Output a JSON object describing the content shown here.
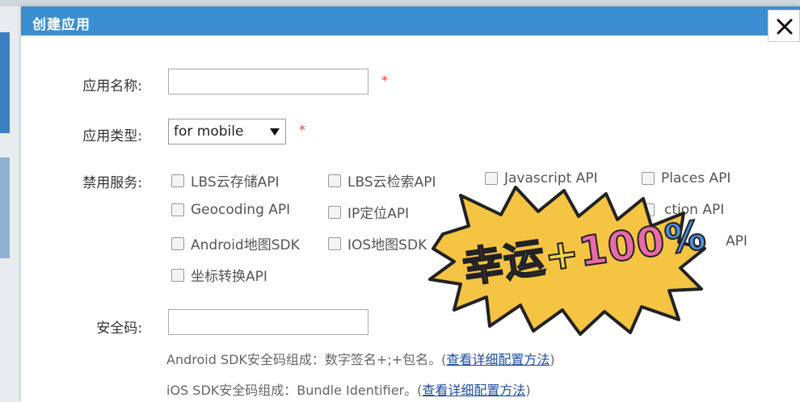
{
  "dialog": {
    "title": "创建应用",
    "close_icon": "close-icon"
  },
  "form": {
    "app_name": {
      "label": "应用名称:",
      "value": "",
      "required_mark": "*"
    },
    "app_type": {
      "label": "应用类型:",
      "selected": "for mobile",
      "required_mark": "*"
    },
    "disabled_services": {
      "label": "禁用服务:",
      "options": [
        {
          "label": "LBS云存储API",
          "checked": false
        },
        {
          "label": "LBS云检索API",
          "checked": false
        },
        {
          "label": "Javascript API",
          "checked": false
        },
        {
          "label": "Places API",
          "checked": false
        },
        {
          "label": "Geocoding API",
          "checked": false
        },
        {
          "label": "IP定位API",
          "checked": false
        },
        {
          "label": "ction API",
          "checked": false
        },
        {
          "label": "Android地图SDK",
          "checked": false
        },
        {
          "label": "IOS地图SDK",
          "checked": false
        },
        {
          "label": "API",
          "checked": false
        },
        {
          "label": "坐标转换API",
          "checked": false
        }
      ]
    },
    "security_code": {
      "label": "安全码:",
      "value": "",
      "hint_android": "Android SDK安全码组成：数字签名+;+包名。(",
      "hint_android_link": "查看详细配置方法",
      "hint_android_end": ")",
      "hint_ios": "iOS SDK安全码组成：Bundle Identifier。(",
      "hint_ios_link": "查看详细配置方法",
      "hint_ios_end": ")"
    }
  },
  "sticker": {
    "text_parts": [
      "幸",
      "运",
      "+",
      "100",
      "%"
    ],
    "fill_color": "#f5c442",
    "outline_color": "#222222"
  }
}
